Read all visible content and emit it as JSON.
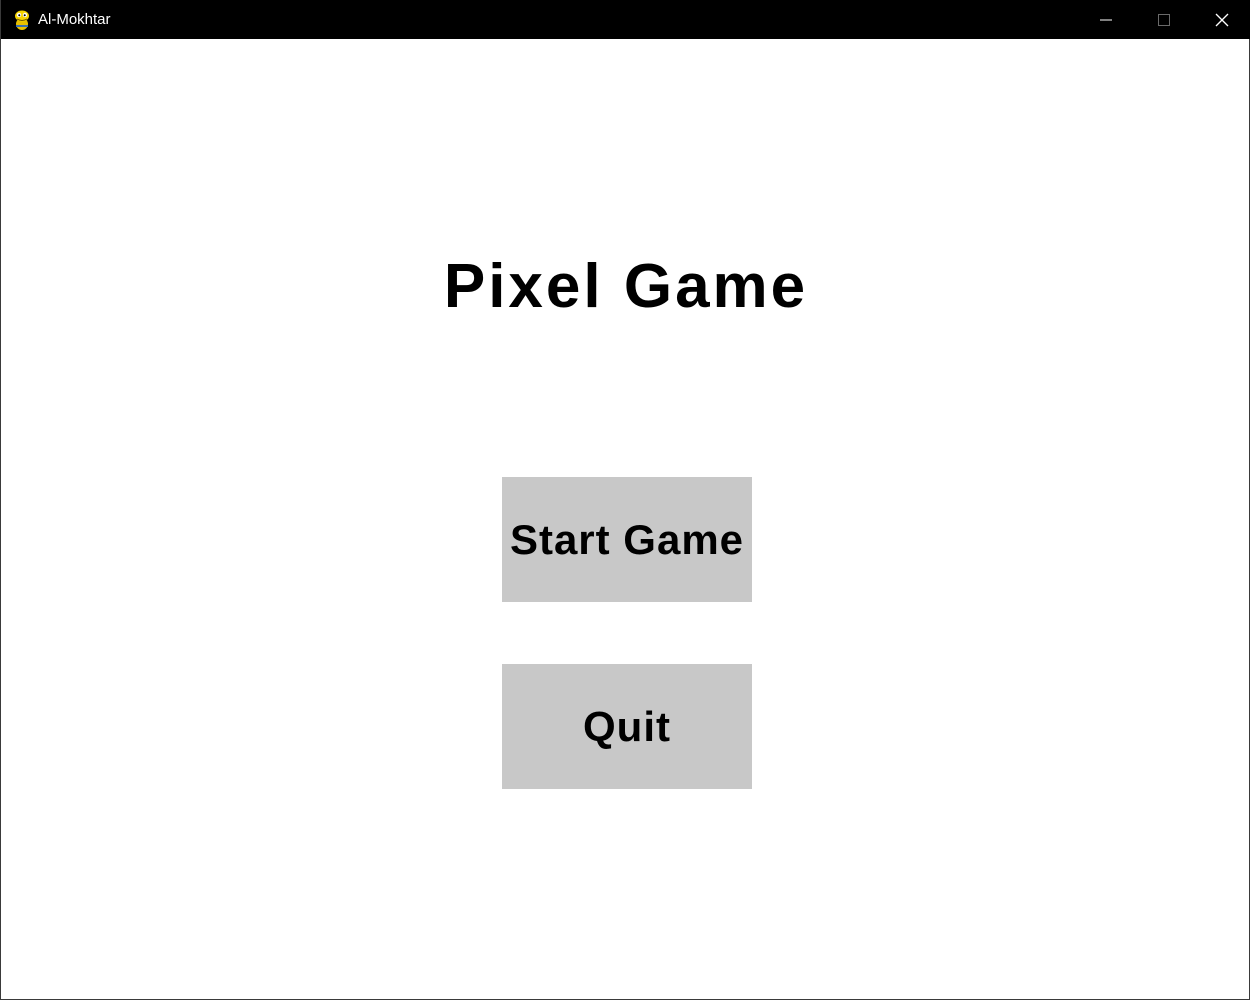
{
  "window": {
    "title": "Al-Mokhtar",
    "icon": "pygame-snake-icon",
    "controls": {
      "minimize_icon": "minimize-icon",
      "maximize_icon": "maximize-icon",
      "close_icon": "close-icon"
    }
  },
  "game": {
    "title": "Pixel Game",
    "buttons": {
      "start_label": "Start Game",
      "quit_label": "Quit"
    }
  },
  "colors": {
    "titlebar": "#000000",
    "background": "#ffffff",
    "button": "#c8c8c8",
    "text": "#000000"
  }
}
